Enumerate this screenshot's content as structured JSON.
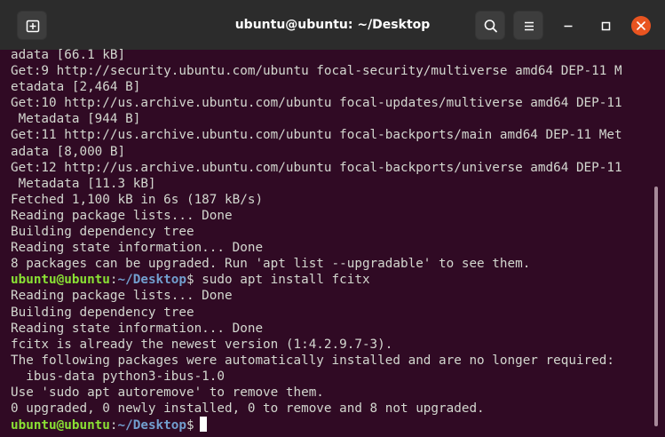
{
  "window": {
    "title": "ubuntu@ubuntu: ~/Desktop"
  },
  "titlebar": {
    "icons": [
      "new-tab-icon",
      "search-icon",
      "hamburger-menu-icon",
      "minimize-icon",
      "maximize-icon",
      "close-icon"
    ]
  },
  "colors": {
    "terminal_bg": "#300a24",
    "titlebar_bg": "#2c2c2c",
    "text": "#d3d7cf",
    "prompt_user": "#8ae234",
    "prompt_path": "#729fcf",
    "close_button": "#e95420"
  },
  "terminal": {
    "lines": [
      "adata [66.1 kB]",
      "Get:9 http://security.ubuntu.com/ubuntu focal-security/multiverse amd64 DEP-11 M",
      "etadata [2,464 B]",
      "Get:10 http://us.archive.ubuntu.com/ubuntu focal-updates/multiverse amd64 DEP-11",
      " Metadata [944 B]",
      "Get:11 http://us.archive.ubuntu.com/ubuntu focal-backports/main amd64 DEP-11 Met",
      "adata [8,000 B]",
      "Get:12 http://us.archive.ubuntu.com/ubuntu focal-backports/universe amd64 DEP-11",
      " Metadata [11.3 kB]",
      "Fetched 1,100 kB in 6s (187 kB/s)",
      "Reading package lists... Done",
      "Building dependency tree",
      "Reading state information... Done",
      "8 packages can be upgraded. Run 'apt list --upgradable' to see them."
    ],
    "prompt1": {
      "user": "ubuntu@ubuntu",
      "colon": ":",
      "path": "~/Desktop",
      "dollar": "$",
      "command": " sudo apt install fcitx"
    },
    "lines2": [
      "Reading package lists... Done",
      "Building dependency tree",
      "Reading state information... Done",
      "fcitx is already the newest version (1:4.2.9.7-3).",
      "The following packages were automatically installed and are no longer required:",
      "  ibus-data python3-ibus-1.0",
      "Use 'sudo apt autoremove' to remove them.",
      "0 upgraded, 0 newly installed, 0 to remove and 8 not upgraded."
    ],
    "prompt2": {
      "user": "ubuntu@ubuntu",
      "colon": ":",
      "path": "~/Desktop",
      "dollar": "$",
      "command": ""
    }
  }
}
